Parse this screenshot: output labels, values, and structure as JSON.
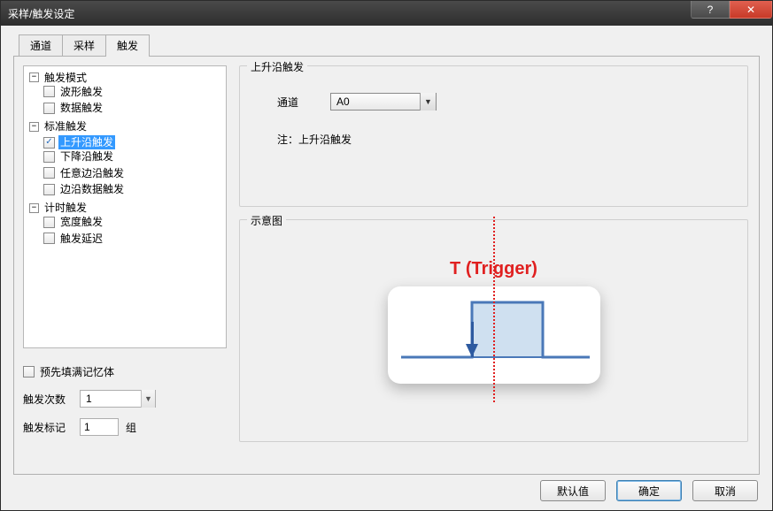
{
  "window": {
    "title": "采样/触发设定"
  },
  "win_controls": {
    "help": "?",
    "close": "X"
  },
  "tabs": [
    {
      "label": "通道"
    },
    {
      "label": "采样"
    },
    {
      "label": "触发"
    }
  ],
  "tree": {
    "root": [
      {
        "label": "触发模式",
        "children": [
          {
            "label": "波形触发",
            "checked": false
          },
          {
            "label": "数据触发",
            "checked": false
          }
        ]
      },
      {
        "label": "标准触发",
        "children": [
          {
            "label": "上升沿触发",
            "checked": true,
            "selected": true
          },
          {
            "label": "下降沿触发",
            "checked": false
          },
          {
            "label": "任意边沿触发",
            "checked": false
          },
          {
            "label": "边沿数据触发",
            "checked": false
          }
        ]
      },
      {
        "label": "计时触发",
        "children": [
          {
            "label": "宽度触发",
            "checked": false
          },
          {
            "label": "触发延迟",
            "checked": false
          }
        ]
      }
    ]
  },
  "left_controls": {
    "prefill_label": "预先填满记忆体",
    "count_label": "触发次数",
    "count_value": "1",
    "mark_label": "触发标记",
    "mark_value": "1",
    "mark_suffix": "组"
  },
  "rising": {
    "group_title": "上升沿触发",
    "channel_label": "通道",
    "channel_value": "A0",
    "note": "注：上升沿触发"
  },
  "schematic": {
    "group_title": "示意图",
    "trigger_label": "T (Trigger)"
  },
  "buttons": {
    "default": "默认值",
    "ok": "确定",
    "cancel": "取消"
  },
  "glyphs": {
    "check": "✓",
    "minus": "−",
    "down": "▼",
    "x": "✕"
  }
}
